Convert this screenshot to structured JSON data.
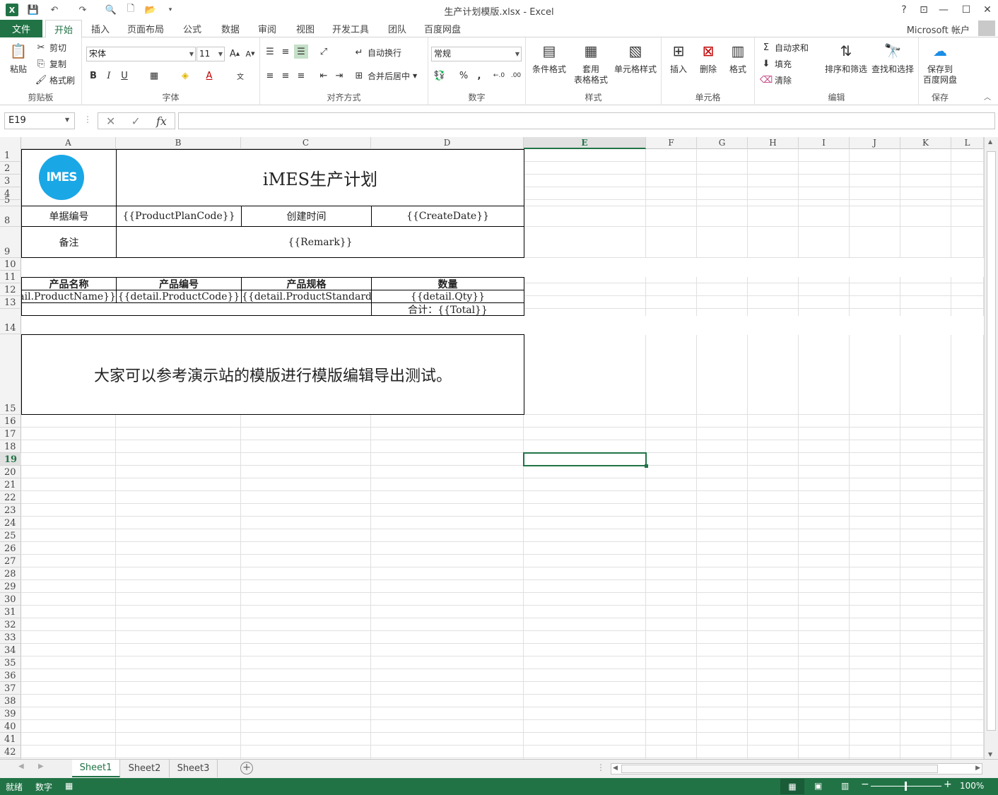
{
  "titlebar": {
    "doc_title": "生产计划模版.xlsx - Excel",
    "help": "?",
    "restore_ribbon": "⊡",
    "minimize": "—",
    "maximize": "☐",
    "close": "✕"
  },
  "tabs": {
    "file": "文件",
    "items": [
      "开始",
      "插入",
      "页面布局",
      "公式",
      "数据",
      "审阅",
      "视图",
      "开发工具",
      "团队",
      "百度网盘"
    ],
    "active": "开始"
  },
  "account": {
    "label": "Microsoft 帐户"
  },
  "ribbon": {
    "clipboard": {
      "label": "剪贴板",
      "paste": "粘贴",
      "cut": "剪切",
      "copy": "复制",
      "format_painter": "格式刷"
    },
    "font": {
      "label": "字体",
      "font_name": "宋体",
      "font_size": "11",
      "bold": "B",
      "italic": "I",
      "underline": "U"
    },
    "alignment": {
      "label": "对齐方式",
      "wrap_text": "自动换行",
      "merge_center": "合并后居中"
    },
    "number": {
      "label": "数字",
      "format": "常规",
      "percent": "%",
      "comma": ","
    },
    "styles": {
      "label": "样式",
      "conditional": "条件格式",
      "table_format_1": "套用",
      "table_format_2": "表格格式",
      "cell_styles": "单元格样式"
    },
    "cells": {
      "label": "单元格",
      "insert": "插入",
      "delete": "删除",
      "format": "格式"
    },
    "editing": {
      "label": "编辑",
      "autosum": "自动求和",
      "fill": "填充",
      "clear": "清除",
      "sort_filter": "排序和筛选",
      "find_select": "查找和选择"
    },
    "save": {
      "label": "保存",
      "save_to_1": "保存到",
      "save_to_2": "百度网盘"
    }
  },
  "formula_bar": {
    "name_box": "E19",
    "fx": "fx",
    "formula": ""
  },
  "columns": [
    "A",
    "B",
    "C",
    "D",
    "E",
    "F",
    "G",
    "H",
    "I",
    "J",
    "K",
    "L"
  ],
  "selected_column": "E",
  "rows": [
    "1",
    "2",
    "3",
    "4",
    "5",
    "8",
    "9",
    "10",
    "11",
    "12",
    "13",
    "14",
    "15",
    "16",
    "17",
    "18",
    "19",
    "20",
    "21",
    "22",
    "23",
    "24",
    "25",
    "26",
    "27",
    "28",
    "29",
    "30",
    "31",
    "32",
    "33",
    "34",
    "35",
    "36",
    "37",
    "38",
    "39",
    "40",
    "41",
    "42"
  ],
  "selected_row": "19",
  "sheet": {
    "logo_text": "IMES",
    "title": "iMES生产计划",
    "doc_no_label": "单据编号",
    "doc_no_value": "{{ProductPlanCode}}",
    "created_label": "创建时间",
    "created_value": "{{CreateDate}}",
    "remark_label": "备注",
    "remark_value": "{{Remark}}",
    "headers": [
      "产品名称",
      "产品编号",
      "产品规格",
      "数量"
    ],
    "detail_row": [
      "{{detail.ProductName}}",
      "{{detail.ProductCode}}",
      "{{detail.ProductStandard}}",
      "{{detail.Qty}}"
    ],
    "total": "合计：{{Total}}",
    "message": "大家可以参考演示站的模版进行模版编辑导出测试。"
  },
  "sheet_tabs": [
    "Sheet1",
    "Sheet2",
    "Sheet3"
  ],
  "active_sheet": "Sheet1",
  "status": {
    "ready": "就绪",
    "num": "数字",
    "zoom": "100%"
  }
}
